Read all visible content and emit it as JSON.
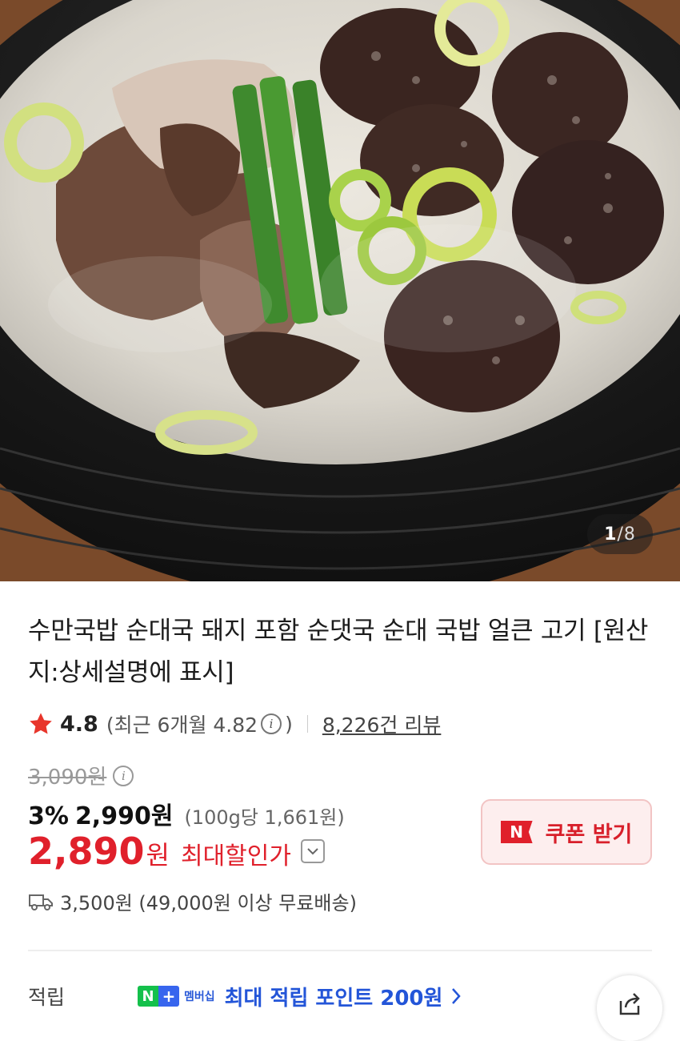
{
  "image": {
    "counter_current": "1",
    "counter_separator": "/",
    "counter_total": "8"
  },
  "product": {
    "title": "수만국밥 순대국 돼지 포함 순댓국 순대 국밥 얼큰 고기 [원산지:상세설명에 표시]",
    "rating": "4.8",
    "recent_prefix": "(최근 6개월 4.82",
    "recent_suffix": ")",
    "review_count": "8,226건 리뷰"
  },
  "price": {
    "original": "3,090원",
    "discount_pct": "3%",
    "sale": "2,990원",
    "unit_price": "(100g당 1,661원)",
    "max_discount_value": "2,890",
    "max_discount_won": "원",
    "max_discount_label": "최대할인가"
  },
  "coupon": {
    "badge": "N",
    "label": "쿠폰 받기"
  },
  "shipping": {
    "text": "3,500원 (49,000원 이상 무료배송)"
  },
  "points": {
    "label": "적립",
    "badge_n": "N",
    "badge_plus": "+",
    "badge_text": "멤버십",
    "text": "최대 적립 포인트 200원"
  },
  "colors": {
    "accent_red": "#e0202b",
    "points_blue": "#2355d8",
    "star": "#e8352b"
  }
}
